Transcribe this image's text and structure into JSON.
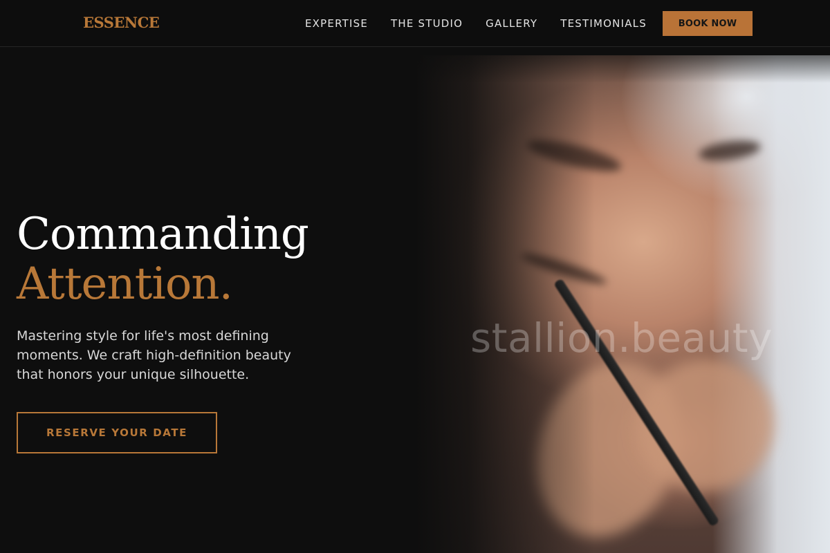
{
  "header": {
    "logo": "ESSENCE",
    "nav": [
      "EXPERTISE",
      "THE STUDIO",
      "GALLERY",
      "TESTIMONIALS"
    ],
    "cta": "BOOK NOW"
  },
  "hero": {
    "headline_line1": "Commanding",
    "headline_line2": "Attention.",
    "tagline": "Mastering style for life's most defining moments. We craft high-definition beauty that honors your unique silhouette.",
    "cta": "RESERVE YOUR DATE",
    "watermark": "stallion.beauty"
  },
  "colors": {
    "accent": "#b87838",
    "background": "#0e0e0e",
    "header_bg": "#0d0d0d",
    "text": "#ffffff"
  }
}
